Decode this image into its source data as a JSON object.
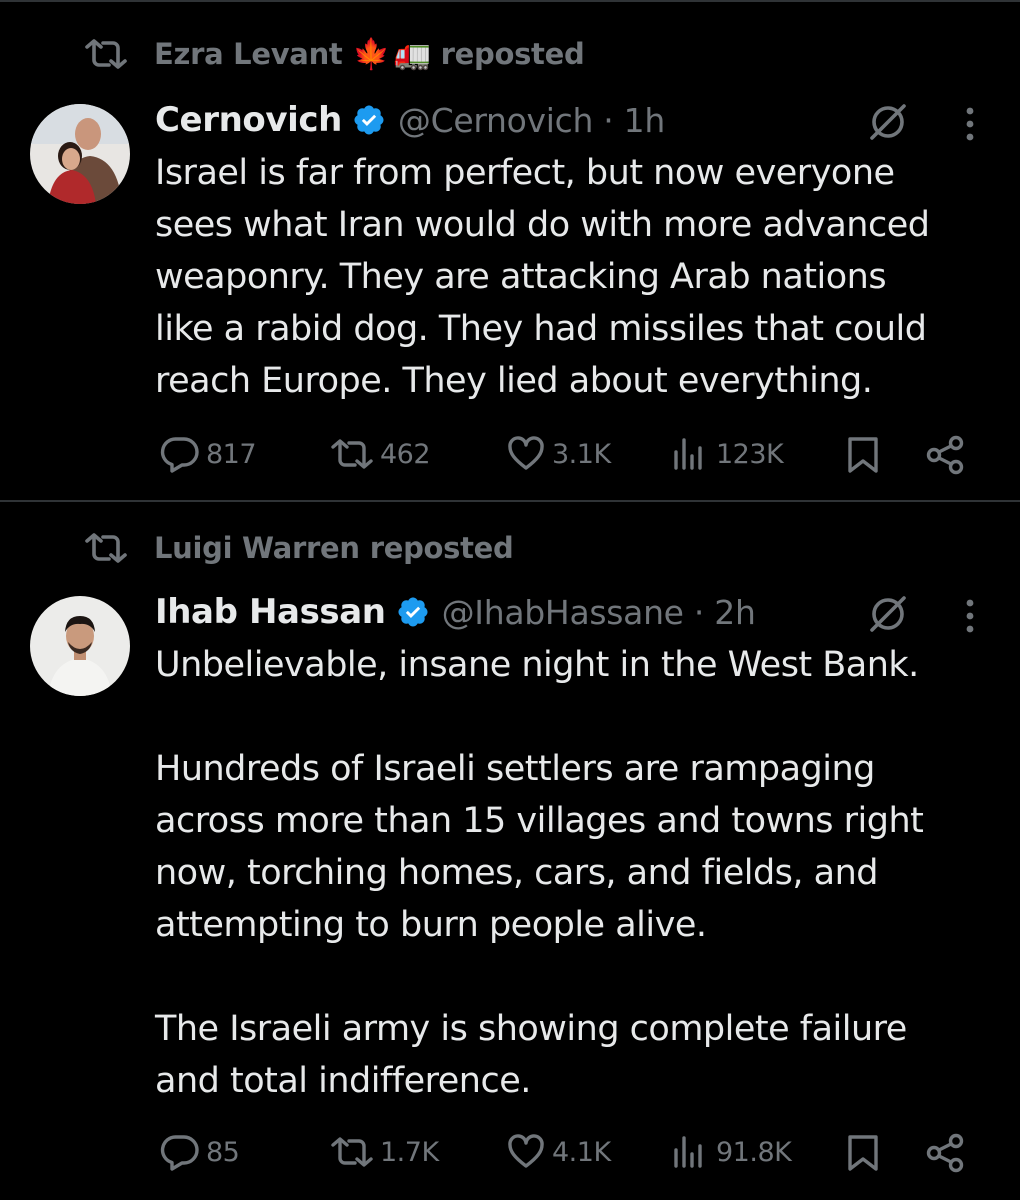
{
  "colors": {
    "background": "#000000",
    "text_primary": "#e7e9ea",
    "text_secondary": "#71767b",
    "verified_blue": "#1d9bf0",
    "divider": "#2f3336"
  },
  "tweets": [
    {
      "repost": {
        "user": "Ezra Levant",
        "emojis": [
          "🍁",
          "🚛"
        ],
        "label": "reposted"
      },
      "author": {
        "display_name": "Cernovich",
        "verified": true,
        "handle_time": "@Cernovich · 1h"
      },
      "text": "Israel is far from perfect, but now everyone sees what Iran would do with more advanced weaponry. They are attacking Arab nations like a rabid dog. They had missiles that could reach Europe. They lied about everything.",
      "text_lines": [
        "Israel is far from perfect, but now everyone",
        "sees what Iran would do with more advanced",
        "weaponry. They are attacking Arab nations",
        "like a rabid dog. They had missiles that could",
        "reach Europe. They lied about everything."
      ],
      "stats": {
        "replies": "817",
        "reposts": "462",
        "likes": "3.1K",
        "views": "123K"
      },
      "icons": [
        "repost-icon",
        "verified-icon",
        "grok-icon",
        "more-icon",
        "reply-icon",
        "retweet-icon",
        "like-icon",
        "views-icon",
        "bookmark-icon",
        "share-icon"
      ]
    },
    {
      "repost": {
        "user": "Luigi Warren",
        "label": "reposted"
      },
      "author": {
        "display_name": "Ihab Hassan",
        "verified": true,
        "handle_time": "@IhabHassane · 2h"
      },
      "text_lines": [
        "Unbelievable, insane night in the West Bank.",
        "",
        "Hundreds of Israeli settlers are rampaging",
        "across more than 15 villages and towns right",
        "now, torching homes, cars, and fields, and",
        "attempting to burn people alive.",
        "",
        "The Israeli army is showing complete failure",
        "and total indifference."
      ],
      "stats": {
        "replies": "85",
        "reposts": "1.7K",
        "likes": "4.1K",
        "views": "91.8K"
      }
    }
  ]
}
